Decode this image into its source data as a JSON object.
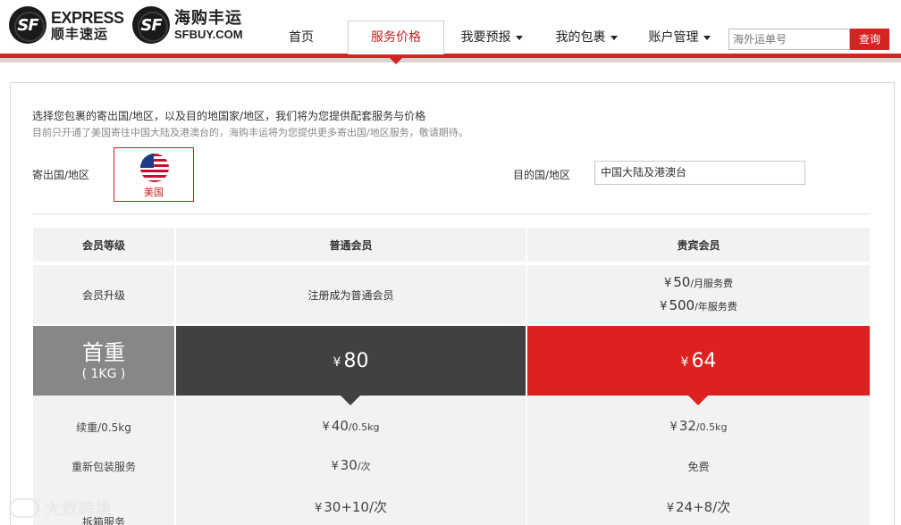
{
  "header": {
    "logo_sf": {
      "mark": "SF",
      "line1": "EXPRESS",
      "line2": "顺丰速运"
    },
    "logo_sfbuy": {
      "mark": "SF",
      "line1": "海购丰运",
      "line2": "SFBUY.COM"
    },
    "nav": {
      "home": "首页",
      "pricing": "服务价格",
      "forecast": "我要预报",
      "packages": "我的包裹",
      "account": "账户管理"
    },
    "search": {
      "placeholder": "海外运单号",
      "button": "查询"
    }
  },
  "intro": {
    "line1": "选择您包裹的寄出国/地区，以及目的地国家/地区，我们将为您提供配套服务与价格",
    "line2": "目前只开通了美国寄往中国大陆及港澳台的，海购丰运将为您提供更多寄出国/地区服务，敬请期待。"
  },
  "selector": {
    "from_label": "寄出国/地区",
    "from_country": "美国",
    "to_label": "目的国/地区",
    "to_value": "中国大陆及港澳台"
  },
  "table": {
    "headers": {
      "level": "会员等级",
      "regular": "普通会员",
      "vip": "贵宾会员"
    },
    "upgrade": {
      "label": "会员升级",
      "regular": "注册成为普通会员",
      "vip_monthly_amount": "50",
      "vip_monthly_unit": "/月服务费",
      "vip_yearly_amount": "500",
      "vip_yearly_unit": "/年服务费"
    },
    "first_weight": {
      "label": "首重",
      "sub": "( 1KG )",
      "regular": "80",
      "vip": "64"
    },
    "additional": {
      "label": "续重/0.5kg",
      "regular_amount": "40",
      "regular_unit": "/0.5kg",
      "vip_amount": "32",
      "vip_unit": "/0.5kg"
    },
    "repack": {
      "label": "重新包装服务",
      "regular_amount": "30",
      "regular_unit": "/次",
      "vip": "免费"
    },
    "split": {
      "label": "拆箱服务",
      "regular_amount": "30+10",
      "regular_unit": "/次",
      "vip_amount": "24+8",
      "vip_unit": "/次"
    },
    "currency": "¥"
  },
  "watermark": {
    "text": "大数跨境"
  },
  "colors": {
    "brand_red": "#d42323",
    "dark": "#414141",
    "vip_red": "#dd2020",
    "gray_label": "#878787"
  }
}
